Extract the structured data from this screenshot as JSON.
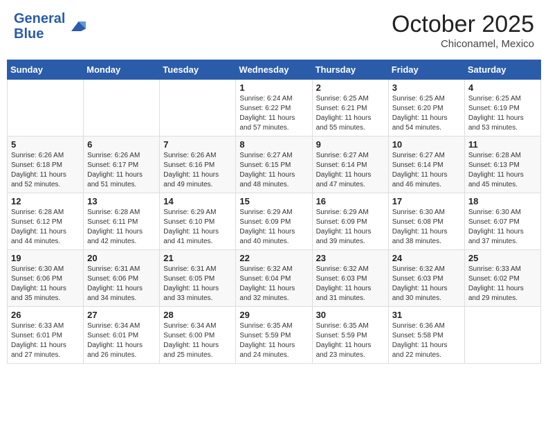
{
  "header": {
    "logo_line1": "General",
    "logo_line2": "Blue",
    "month": "October 2025",
    "location": "Chiconamel, Mexico"
  },
  "days_of_week": [
    "Sunday",
    "Monday",
    "Tuesday",
    "Wednesday",
    "Thursday",
    "Friday",
    "Saturday"
  ],
  "weeks": [
    [
      {
        "day": "",
        "info": ""
      },
      {
        "day": "",
        "info": ""
      },
      {
        "day": "",
        "info": ""
      },
      {
        "day": "1",
        "info": "Sunrise: 6:24 AM\nSunset: 6:22 PM\nDaylight: 11 hours\nand 57 minutes."
      },
      {
        "day": "2",
        "info": "Sunrise: 6:25 AM\nSunset: 6:21 PM\nDaylight: 11 hours\nand 55 minutes."
      },
      {
        "day": "3",
        "info": "Sunrise: 6:25 AM\nSunset: 6:20 PM\nDaylight: 11 hours\nand 54 minutes."
      },
      {
        "day": "4",
        "info": "Sunrise: 6:25 AM\nSunset: 6:19 PM\nDaylight: 11 hours\nand 53 minutes."
      }
    ],
    [
      {
        "day": "5",
        "info": "Sunrise: 6:26 AM\nSunset: 6:18 PM\nDaylight: 11 hours\nand 52 minutes."
      },
      {
        "day": "6",
        "info": "Sunrise: 6:26 AM\nSunset: 6:17 PM\nDaylight: 11 hours\nand 51 minutes."
      },
      {
        "day": "7",
        "info": "Sunrise: 6:26 AM\nSunset: 6:16 PM\nDaylight: 11 hours\nand 49 minutes."
      },
      {
        "day": "8",
        "info": "Sunrise: 6:27 AM\nSunset: 6:15 PM\nDaylight: 11 hours\nand 48 minutes."
      },
      {
        "day": "9",
        "info": "Sunrise: 6:27 AM\nSunset: 6:14 PM\nDaylight: 11 hours\nand 47 minutes."
      },
      {
        "day": "10",
        "info": "Sunrise: 6:27 AM\nSunset: 6:14 PM\nDaylight: 11 hours\nand 46 minutes."
      },
      {
        "day": "11",
        "info": "Sunrise: 6:28 AM\nSunset: 6:13 PM\nDaylight: 11 hours\nand 45 minutes."
      }
    ],
    [
      {
        "day": "12",
        "info": "Sunrise: 6:28 AM\nSunset: 6:12 PM\nDaylight: 11 hours\nand 44 minutes."
      },
      {
        "day": "13",
        "info": "Sunrise: 6:28 AM\nSunset: 6:11 PM\nDaylight: 11 hours\nand 42 minutes."
      },
      {
        "day": "14",
        "info": "Sunrise: 6:29 AM\nSunset: 6:10 PM\nDaylight: 11 hours\nand 41 minutes."
      },
      {
        "day": "15",
        "info": "Sunrise: 6:29 AM\nSunset: 6:09 PM\nDaylight: 11 hours\nand 40 minutes."
      },
      {
        "day": "16",
        "info": "Sunrise: 6:29 AM\nSunset: 6:09 PM\nDaylight: 11 hours\nand 39 minutes."
      },
      {
        "day": "17",
        "info": "Sunrise: 6:30 AM\nSunset: 6:08 PM\nDaylight: 11 hours\nand 38 minutes."
      },
      {
        "day": "18",
        "info": "Sunrise: 6:30 AM\nSunset: 6:07 PM\nDaylight: 11 hours\nand 37 minutes."
      }
    ],
    [
      {
        "day": "19",
        "info": "Sunrise: 6:30 AM\nSunset: 6:06 PM\nDaylight: 11 hours\nand 35 minutes."
      },
      {
        "day": "20",
        "info": "Sunrise: 6:31 AM\nSunset: 6:06 PM\nDaylight: 11 hours\nand 34 minutes."
      },
      {
        "day": "21",
        "info": "Sunrise: 6:31 AM\nSunset: 6:05 PM\nDaylight: 11 hours\nand 33 minutes."
      },
      {
        "day": "22",
        "info": "Sunrise: 6:32 AM\nSunset: 6:04 PM\nDaylight: 11 hours\nand 32 minutes."
      },
      {
        "day": "23",
        "info": "Sunrise: 6:32 AM\nSunset: 6:03 PM\nDaylight: 11 hours\nand 31 minutes."
      },
      {
        "day": "24",
        "info": "Sunrise: 6:32 AM\nSunset: 6:03 PM\nDaylight: 11 hours\nand 30 minutes."
      },
      {
        "day": "25",
        "info": "Sunrise: 6:33 AM\nSunset: 6:02 PM\nDaylight: 11 hours\nand 29 minutes."
      }
    ],
    [
      {
        "day": "26",
        "info": "Sunrise: 6:33 AM\nSunset: 6:01 PM\nDaylight: 11 hours\nand 27 minutes."
      },
      {
        "day": "27",
        "info": "Sunrise: 6:34 AM\nSunset: 6:01 PM\nDaylight: 11 hours\nand 26 minutes."
      },
      {
        "day": "28",
        "info": "Sunrise: 6:34 AM\nSunset: 6:00 PM\nDaylight: 11 hours\nand 25 minutes."
      },
      {
        "day": "29",
        "info": "Sunrise: 6:35 AM\nSunset: 5:59 PM\nDaylight: 11 hours\nand 24 minutes."
      },
      {
        "day": "30",
        "info": "Sunrise: 6:35 AM\nSunset: 5:59 PM\nDaylight: 11 hours\nand 23 minutes."
      },
      {
        "day": "31",
        "info": "Sunrise: 6:36 AM\nSunset: 5:58 PM\nDaylight: 11 hours\nand 22 minutes."
      },
      {
        "day": "",
        "info": ""
      }
    ]
  ]
}
